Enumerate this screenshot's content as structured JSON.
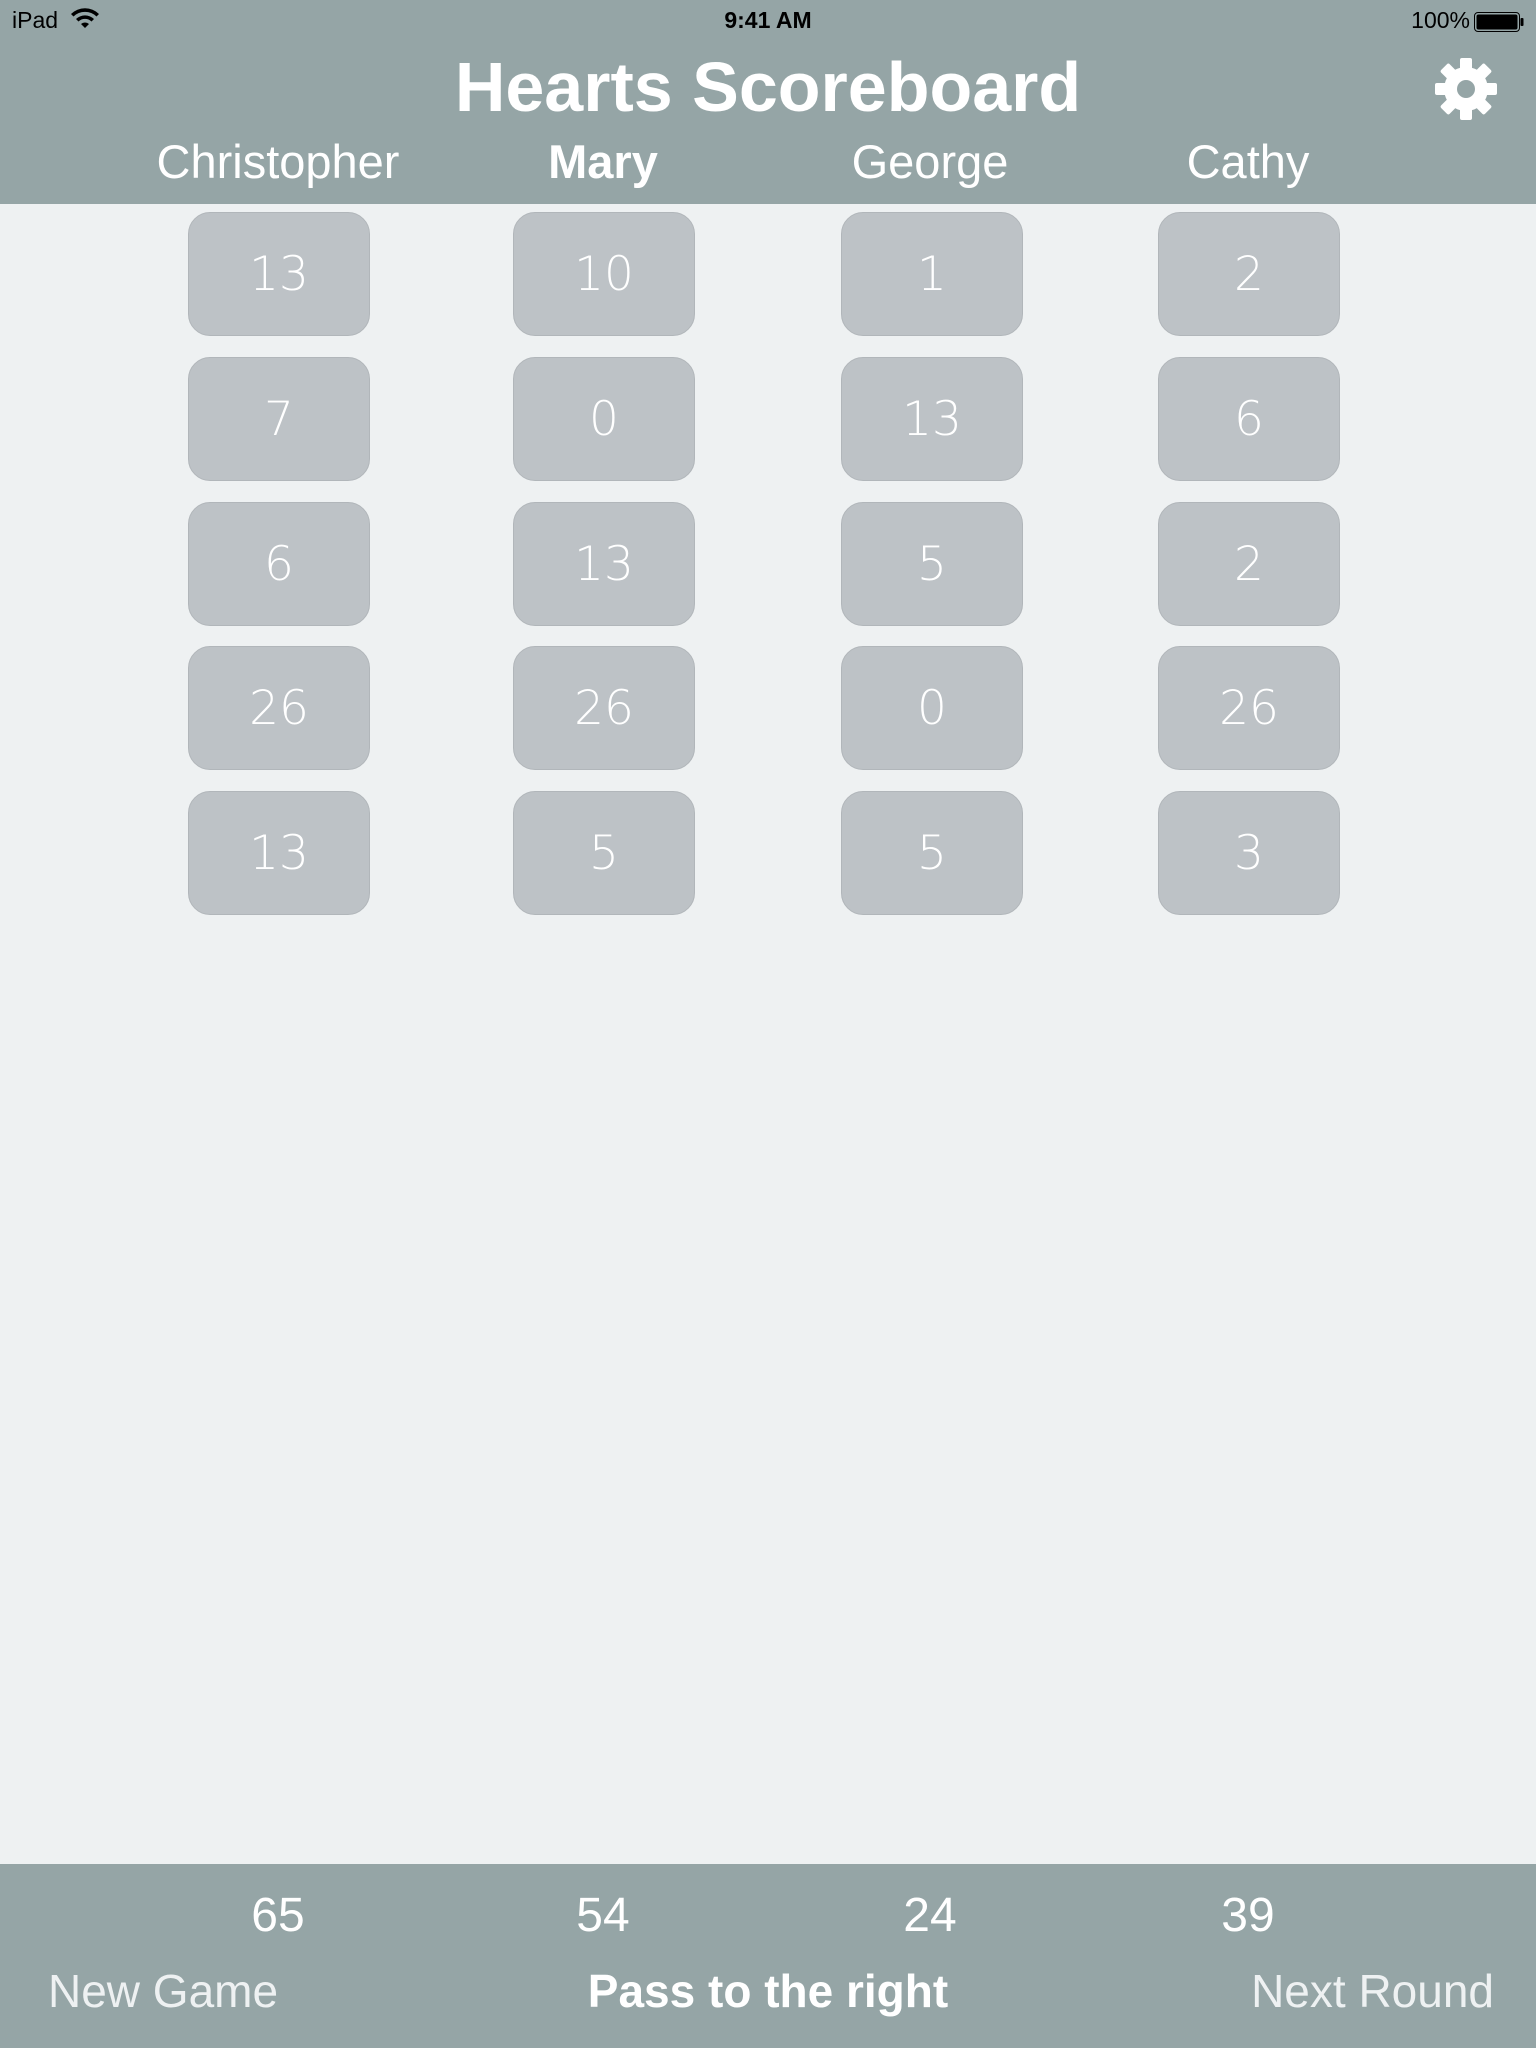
{
  "status_bar": {
    "device": "iPad",
    "time": "9:41 AM",
    "battery": "100%",
    "wifi_icon": "wifi-icon",
    "battery_icon": "battery-icon"
  },
  "header": {
    "title": "Hearts Scoreboard",
    "settings_icon": "gear-icon",
    "players": [
      {
        "name": "Christopher",
        "selected": false
      },
      {
        "name": "Mary",
        "selected": true
      },
      {
        "name": "George",
        "selected": false
      },
      {
        "name": "Cathy",
        "selected": false
      }
    ]
  },
  "scores": {
    "rounds": [
      [
        "13",
        "10",
        "1",
        "2"
      ],
      [
        "7",
        "0",
        "13",
        "6"
      ],
      [
        "6",
        "13",
        "5",
        "2"
      ],
      [
        "26",
        "26",
        "0",
        "26"
      ],
      [
        "13",
        "5",
        "5",
        "3"
      ]
    ]
  },
  "footer": {
    "totals": [
      "65",
      "54",
      "24",
      "39"
    ],
    "new_game": "New Game",
    "pass_direction": "Pass to the right",
    "next_round": "Next Round"
  },
  "colors": {
    "bar": "#95a5a6",
    "background": "#eef1f2",
    "cell": "#bdc2c6",
    "text": "#ffffff"
  }
}
